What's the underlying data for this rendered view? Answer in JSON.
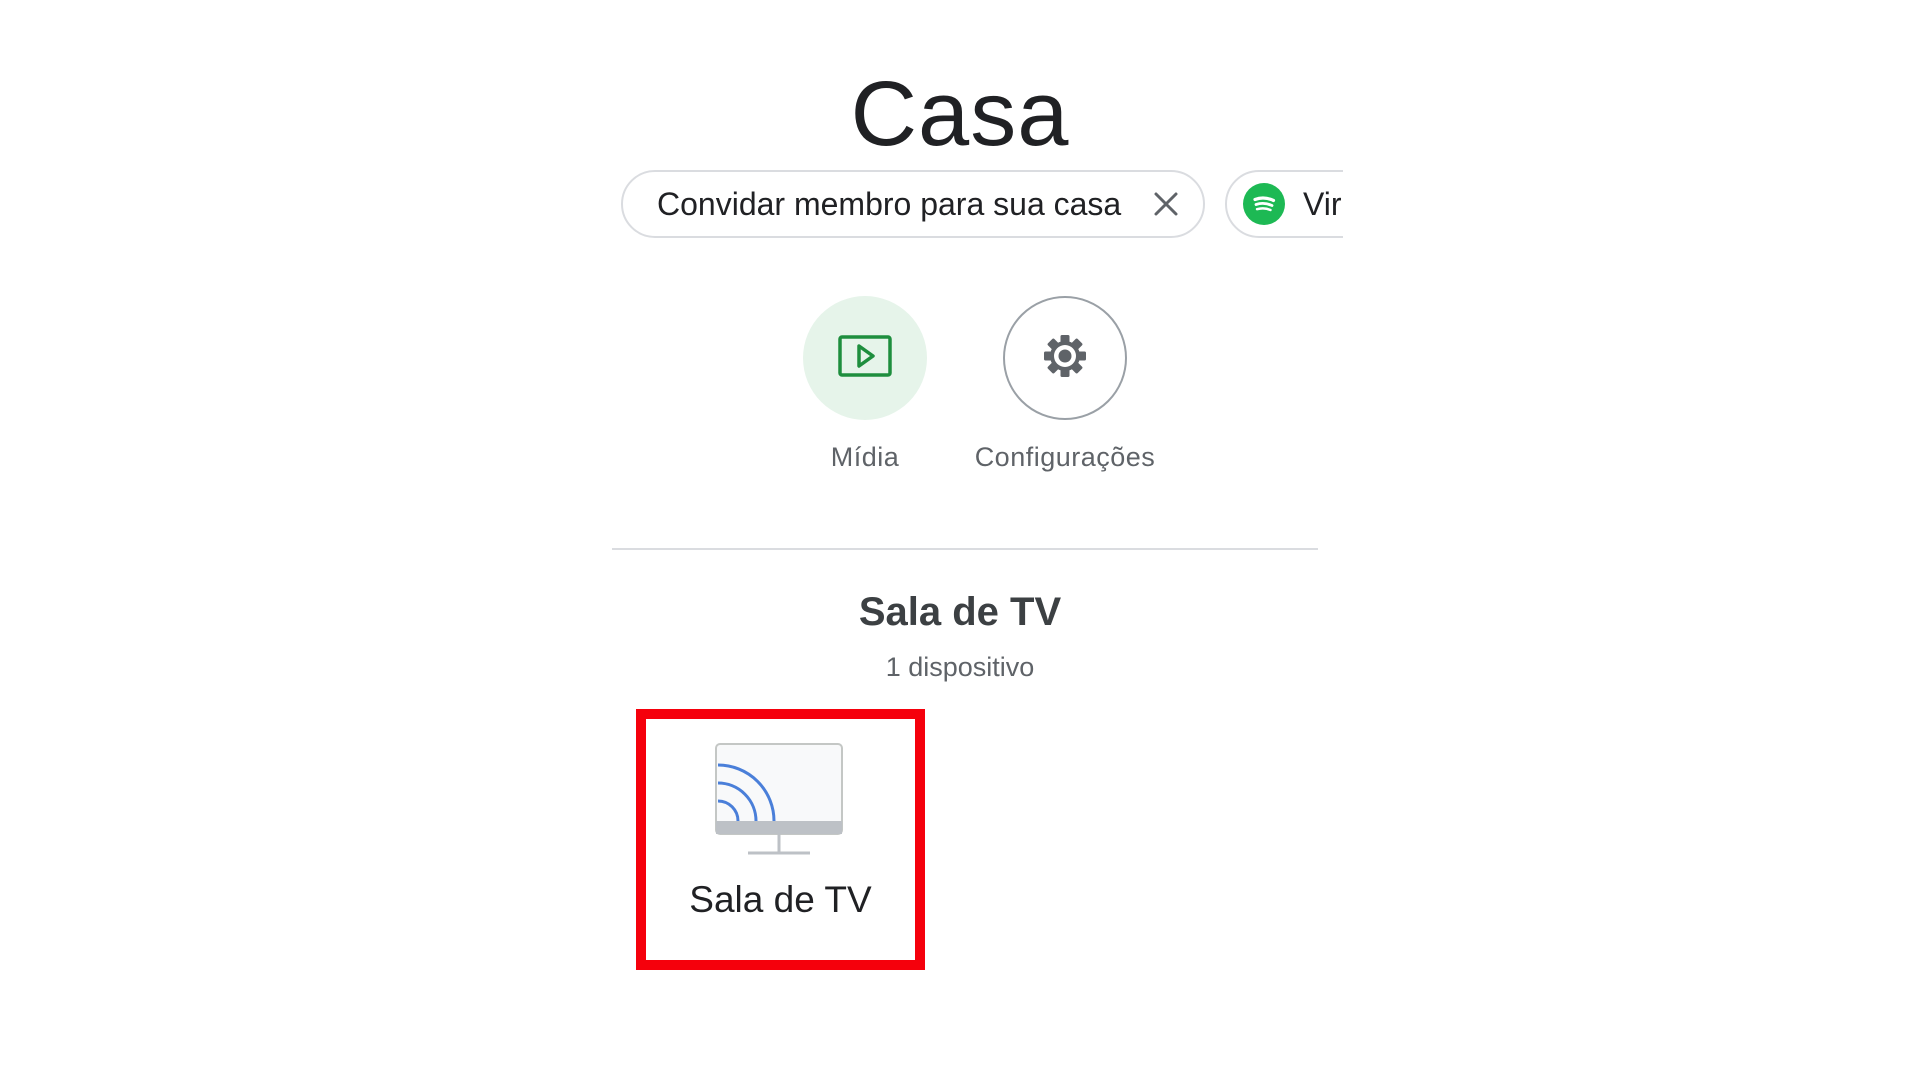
{
  "home": {
    "title": "Casa"
  },
  "chips": {
    "invite": {
      "label": "Convidar membro para sua casa",
      "close_icon": "close-icon"
    },
    "spotify": {
      "label": "Vir",
      "icon": "spotify-icon",
      "icon_color": "#1db954"
    }
  },
  "actions": [
    {
      "label": "Mídia",
      "icon": "media-play-icon",
      "accent": "#1e8e3e",
      "background": "#e6f4ea"
    },
    {
      "label": "Configurações",
      "icon": "gear-icon"
    }
  ],
  "room": {
    "title": "Sala de TV",
    "subtitle": "1 dispositivo",
    "devices": [
      {
        "label": "Sala de TV",
        "icon": "tv-cast-icon",
        "highlight_color": "#f5000c"
      }
    ]
  }
}
